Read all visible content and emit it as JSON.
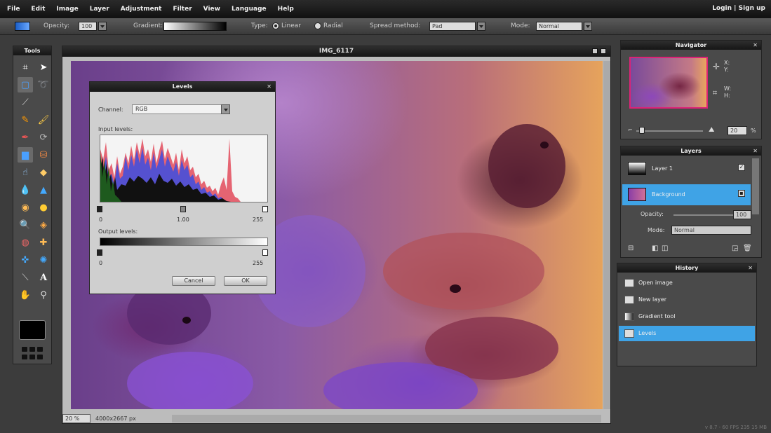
{
  "menubar": {
    "items": [
      "File",
      "Edit",
      "Image",
      "Layer",
      "Adjustment",
      "Filter",
      "View",
      "Language",
      "Help"
    ],
    "auth": "Login  |  Sign up"
  },
  "options": {
    "opacity_label": "Opacity:",
    "opacity_value": "100",
    "gradient_label": "Gradient:",
    "type_label": "Type:",
    "type_linear": "Linear",
    "type_radial": "Radial",
    "spread_label": "Spread method:",
    "spread_value": "Pad",
    "mode_label": "Mode:",
    "mode_value": "Normal"
  },
  "tools": {
    "title": "Tools",
    "icons": [
      "crop-icon",
      "move-icon",
      "marquee-icon",
      "lasso-icon",
      "magic-wand-icon",
      "blank",
      "pencil-icon",
      "brush-icon",
      "clone-icon",
      "color-replace-icon",
      "gradient-icon",
      "bucket-icon",
      "smudge-icon",
      "eraser-icon",
      "blur-icon",
      "sharpen-icon",
      "sponge-icon",
      "dodge-icon",
      "zoom-icon",
      "shape-icon",
      "red-eye-icon",
      "spot-heal-icon",
      "bloat-icon",
      "pinch-icon",
      "eyedropper-icon",
      "text-icon",
      "hand-icon",
      "magnifier-icon"
    ]
  },
  "document": {
    "title": "IMG_6117",
    "zoom": "20  %",
    "size": "4000x2667 px"
  },
  "levels": {
    "title": "Levels",
    "channel_label": "Channel:",
    "channel_value": "RGB",
    "input_label": "Input levels:",
    "in_black": "0",
    "in_gamma": "1.00",
    "in_white": "255",
    "output_label": "Output levels:",
    "out_black": "0",
    "out_white": "255",
    "cancel": "Cancel",
    "ok": "OK"
  },
  "navigator": {
    "title": "Navigator",
    "x": "X:",
    "y": "Y:",
    "w": "W:",
    "h": "H:",
    "zoom": "20"
  },
  "layers": {
    "title": "Layers",
    "items": [
      {
        "label": "Layer 1"
      },
      {
        "label": "Background"
      }
    ],
    "opacity_label": "Opacity:",
    "opacity_value": "100",
    "mode_label": "Mode:",
    "mode_value": "Normal"
  },
  "history": {
    "title": "History",
    "items": [
      {
        "label": "Open image"
      },
      {
        "label": "New layer"
      },
      {
        "label": "Gradient tool"
      },
      {
        "label": "Levels"
      }
    ]
  },
  "version": "v 8.7 - 60 FPS 235 15 MB"
}
